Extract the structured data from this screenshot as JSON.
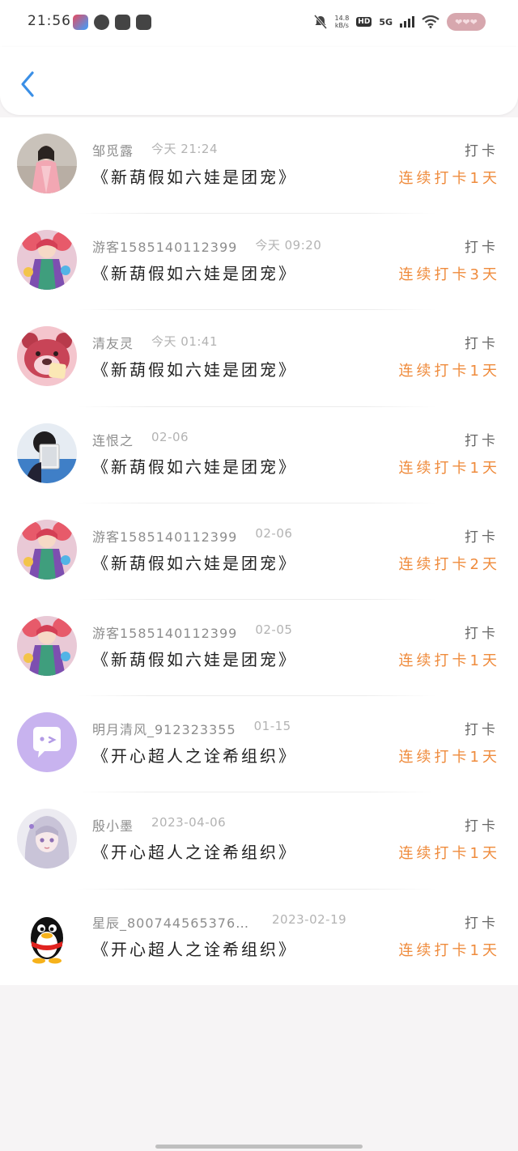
{
  "status_bar": {
    "time": "21:56",
    "speed_value": "14.8",
    "speed_unit": "kB/s",
    "hd": "HD",
    "network": "5G",
    "battery_deco": "❤❤❤"
  },
  "colors": {
    "accent_back": "#3b8fe6",
    "streak_orange": "#ef8b3c",
    "username_gray": "#8d8d8d"
  },
  "nav": {
    "back_icon": "chevron-left-icon"
  },
  "records": [
    {
      "user": "邹觅露",
      "time": "今天 21:24",
      "title": "《新葫假如六娃是团宠》",
      "action": "打卡",
      "streak": "连续打卡1天",
      "avatar": "girl-portrait"
    },
    {
      "user": "游客1585140112399",
      "time": "今天 09:20",
      "title": "《新葫假如六娃是团宠》",
      "action": "打卡",
      "streak": "连续打卡3天",
      "avatar": "anime-character"
    },
    {
      "user": "清友灵",
      "time": "今天 01:41",
      "title": "《新葫假如六娃是团宠》",
      "action": "打卡",
      "streak": "连续打卡1天",
      "avatar": "pink-bear"
    },
    {
      "user": "连恨之",
      "time": "02-06",
      "title": "《新葫假如六娃是团宠》",
      "action": "打卡",
      "streak": "连续打卡1天",
      "avatar": "girl-with-tablet"
    },
    {
      "user": "游客1585140112399",
      "time": "02-06",
      "title": "《新葫假如六娃是团宠》",
      "action": "打卡",
      "streak": "连续打卡2天",
      "avatar": "anime-character"
    },
    {
      "user": "游客1585140112399",
      "time": "02-05",
      "title": "《新葫假如六娃是团宠》",
      "action": "打卡",
      "streak": "连续打卡1天",
      "avatar": "anime-character"
    },
    {
      "user": "明月清风_912323355",
      "time": "01-15",
      "title": "《开心超人之诠希组织》",
      "action": "打卡",
      "streak": "连续打卡1天",
      "avatar": "chat-bubble"
    },
    {
      "user": "殷小墨",
      "time": "2023-04-06",
      "title": "《开心超人之诠希组织》",
      "action": "打卡",
      "streak": "连续打卡1天",
      "avatar": "anime-girl-silver"
    },
    {
      "user": "星辰_8007445653768...",
      "time": "2023-02-19",
      "title": "《开心超人之诠希组织》",
      "action": "打卡",
      "streak": "连续打卡1天",
      "avatar": "qq-penguin"
    }
  ]
}
